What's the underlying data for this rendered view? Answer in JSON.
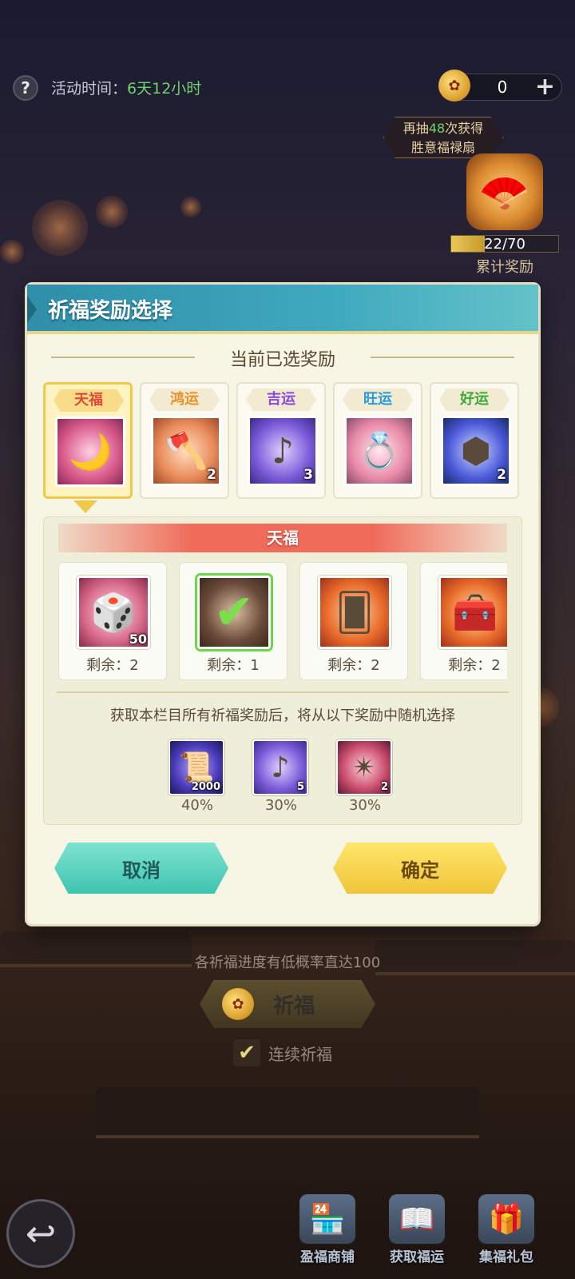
{
  "topbar": {
    "help_icon": "question-mark",
    "event_time_label": "活动时间：",
    "event_time_value": "6天12小时",
    "currency_icon": "fortune-coin-icon",
    "currency_value": "0",
    "currency_plus": "+"
  },
  "milestone": {
    "hint_prefix": "再抽",
    "hint_count": "48",
    "hint_suffix": "次获得",
    "hint_reward": "胜意福禄扇",
    "progress_text": "22/70",
    "progress_fraction": 0.314,
    "label": "累计奖励"
  },
  "dialog": {
    "title": "祈福奖励选择",
    "section_title": "当前已选奖励",
    "tiers": [
      {
        "label": "天福",
        "color": "#e04a3a",
        "qty": "",
        "selected": true,
        "icon": "crescent-orb"
      },
      {
        "label": "鸿运",
        "color": "#e8902a",
        "qty": "2",
        "selected": false,
        "icon": "axe"
      },
      {
        "label": "吉运",
        "color": "#8a4ad8",
        "qty": "3",
        "selected": false,
        "icon": "music-orb"
      },
      {
        "label": "旺运",
        "color": "#2a9ad8",
        "qty": "",
        "selected": false,
        "icon": "chest-ring"
      },
      {
        "label": "好运",
        "color": "#3aaa3a",
        "qty": "2",
        "selected": false,
        "icon": "hex-rune"
      }
    ],
    "current_tier_banner": "天福",
    "rewards": [
      {
        "qty": "50",
        "remaining": "剩余：2",
        "icon": "crystal-cube",
        "checked": false
      },
      {
        "qty": "",
        "remaining": "剩余：1",
        "icon": "leaf-seed",
        "checked": true
      },
      {
        "qty": "",
        "remaining": "剩余：2",
        "icon": "card",
        "checked": false
      },
      {
        "qty": "",
        "remaining": "剩余：2",
        "icon": "golden-chest",
        "checked": false
      }
    ],
    "random_note": "获取本栏目所有祈福奖励后，将从以下奖励中随机选择",
    "random_rewards": [
      {
        "qty": "2000",
        "pct": "40%",
        "icon": "scroll"
      },
      {
        "qty": "5",
        "pct": "30%",
        "icon": "music-orb"
      },
      {
        "qty": "2",
        "pct": "30%",
        "icon": "star-crystal"
      }
    ],
    "cancel_label": "取消",
    "confirm_label": "确定"
  },
  "below": {
    "rate_note": "各祈福进度有低概率直达100",
    "pray_label": "祈福",
    "continuous_label": "连续祈福",
    "continuous_checked": true
  },
  "nav": {
    "back_icon": "return-arrow-icon",
    "items": [
      {
        "label": "盈福商铺",
        "icon": "shop-icon"
      },
      {
        "label": "获取福运",
        "icon": "book-icon"
      },
      {
        "label": "集福礼包",
        "icon": "gift-icon"
      }
    ]
  }
}
